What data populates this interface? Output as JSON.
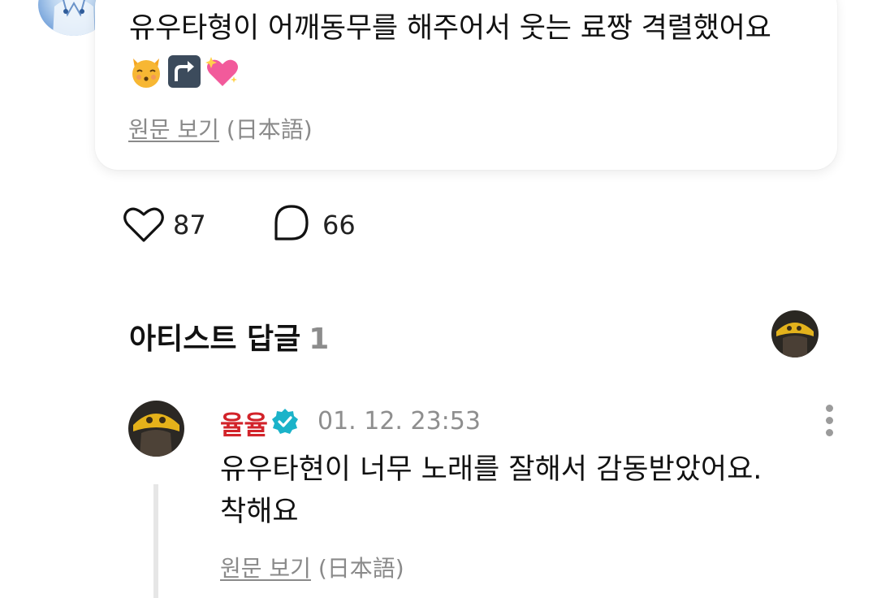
{
  "post": {
    "text": "유우타형이 어깨동무를 해주어서 웃는 료짱 격렬했어요",
    "emojis": [
      "kissing-cat-emoji",
      "arrow-up-right-emoji",
      "sparkling-heart-emoji"
    ],
    "view_original_label": "원문 보기",
    "original_language": "(日本語)"
  },
  "reactions": {
    "likes": "87",
    "comments": "66"
  },
  "artist_replies": {
    "title": "아티스트 답글",
    "count": "1"
  },
  "reply": {
    "author": "율율",
    "timestamp": "01. 12. 23:53",
    "text_line1": "유우타현이 너무 노래를 잘해서 감동받았어요.",
    "text_line2": "착해요",
    "view_original_label": "원문 보기",
    "original_language": "(日本語)"
  },
  "colors": {
    "author_name": "#d2232a",
    "verified_badge": "#1bb3c9",
    "muted_text": "#8a8a8a"
  }
}
